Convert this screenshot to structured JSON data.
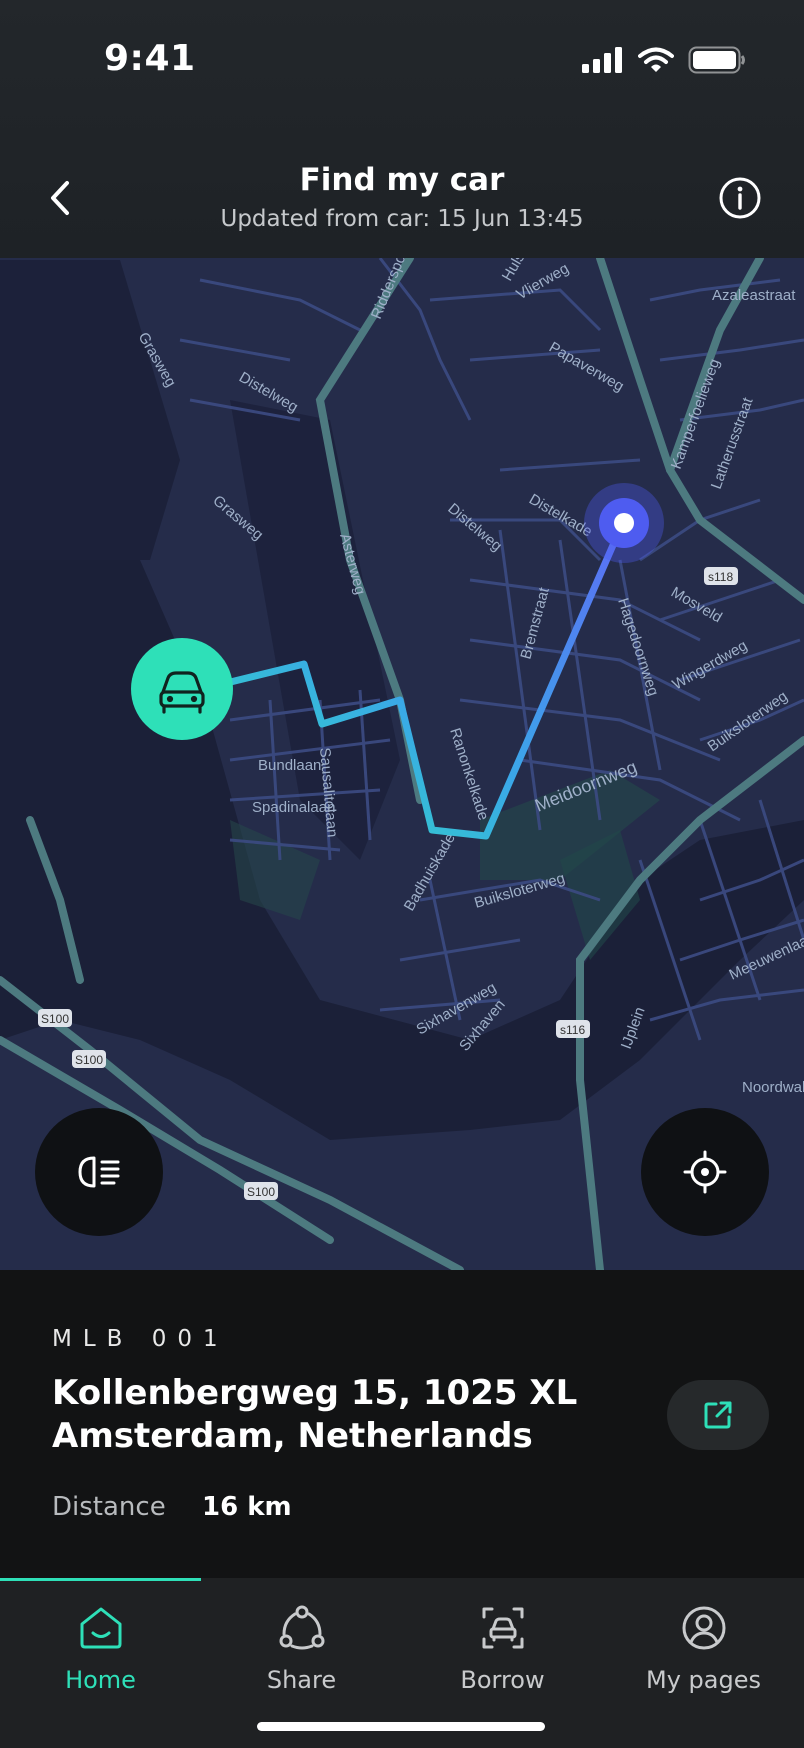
{
  "status_bar": {
    "time": "9:41"
  },
  "header": {
    "title": "Find my car",
    "subtitle": "Updated from car: 15 Jun 13:45"
  },
  "map": {
    "street_labels": [
      "Ridderspoorweg",
      "Hulst",
      "Vlierweg",
      "Meeuwenlaan",
      "Azaleastraat",
      "Grasweg",
      "Distelweg",
      "Papaverweg",
      "Kamperfoelieweg",
      "Latherusstraat",
      "Distelkade",
      "Asterweg",
      "s118",
      "Mosveld",
      "Hagedoornweg",
      "Bremstraat",
      "Wingerdweg",
      "Buiksloterweg",
      "Bundlaan",
      "Sausalitolaan",
      "Spadinalaan",
      "Ranonkelkade",
      "Meidoornweg",
      "Badhuiskade",
      "Sixhavenweg",
      "Sixhaven",
      "s116",
      "IJplein",
      "Noordwal",
      "S100",
      "S100",
      "S100"
    ],
    "route_colors": {
      "start": "#2ee0b8",
      "end": "#5d6cf5"
    },
    "car_marker_color": "#2ee0b8",
    "user_marker_color": "#4e5cf0"
  },
  "panel": {
    "plate": "MLB 001",
    "address_line1": "Kollenbergweg 15, 1025 XL",
    "address_line2": "Amsterdam, Netherlands",
    "distance_label": "Distance",
    "distance_value": "16 km"
  },
  "tabs": [
    {
      "label": "Home",
      "icon": "home-icon",
      "active": true
    },
    {
      "label": "Share",
      "icon": "share-icon",
      "active": false
    },
    {
      "label": "Borrow",
      "icon": "borrow-car-icon",
      "active": false
    },
    {
      "label": "My pages",
      "icon": "user-icon",
      "active": false
    }
  ],
  "accent_color": "#2ee0b8"
}
